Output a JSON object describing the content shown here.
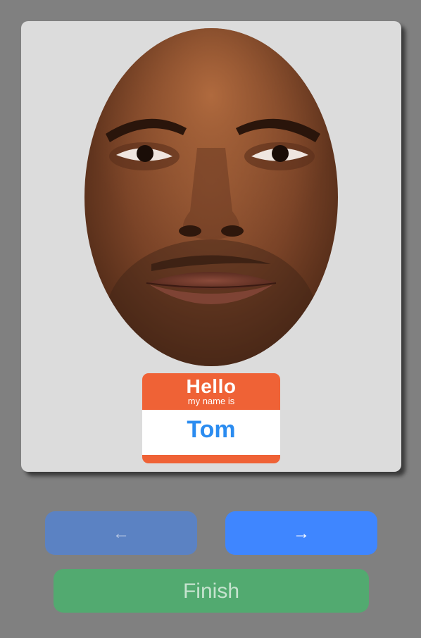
{
  "card": {
    "photo_alt": "face photo"
  },
  "name_tag": {
    "hello": "Hello",
    "subtitle": "my name is",
    "name": "Tom"
  },
  "nav": {
    "prev_label": "←",
    "next_label": "→",
    "finish_label": "Finish"
  },
  "colors": {
    "background": "#808080",
    "card": "#dcdcdc",
    "tag_orange": "#ef6236",
    "name_blue": "#2b8cf0",
    "prev_button": "#5b82c3",
    "next_button": "#3f86ff",
    "finish_button": "#52aa70"
  }
}
